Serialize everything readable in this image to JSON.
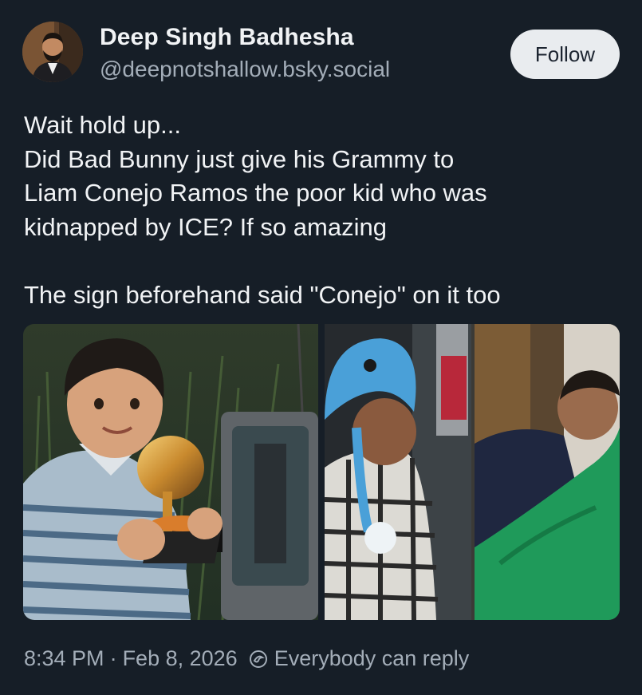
{
  "author": {
    "name": "Deep Singh Badhesha",
    "handle": "@deepnotshallow.bsky.social"
  },
  "follow_label": "Follow",
  "post": {
    "lines": [
      "Wait hold up...",
      "Did Bad Bunny just give his Grammy to",
      "Liam Conejo Ramos the poor kid who was",
      "kidnapped by ICE? If so amazing"
    ],
    "second_paragraph": "The sign beforehand said \"Conejo\" on it too"
  },
  "meta": {
    "time": "8:34 PM",
    "separator": "·",
    "date": "Feb 8, 2026",
    "reply_setting": "Everybody can reply"
  },
  "icons": {
    "reply_setting": "globe-reply-icon",
    "avatar": "avatar"
  },
  "colors": {
    "background": "#161e27",
    "text": "#f1f3f5",
    "muted": "#a3adb8",
    "follow_bg": "#e9ecef"
  }
}
